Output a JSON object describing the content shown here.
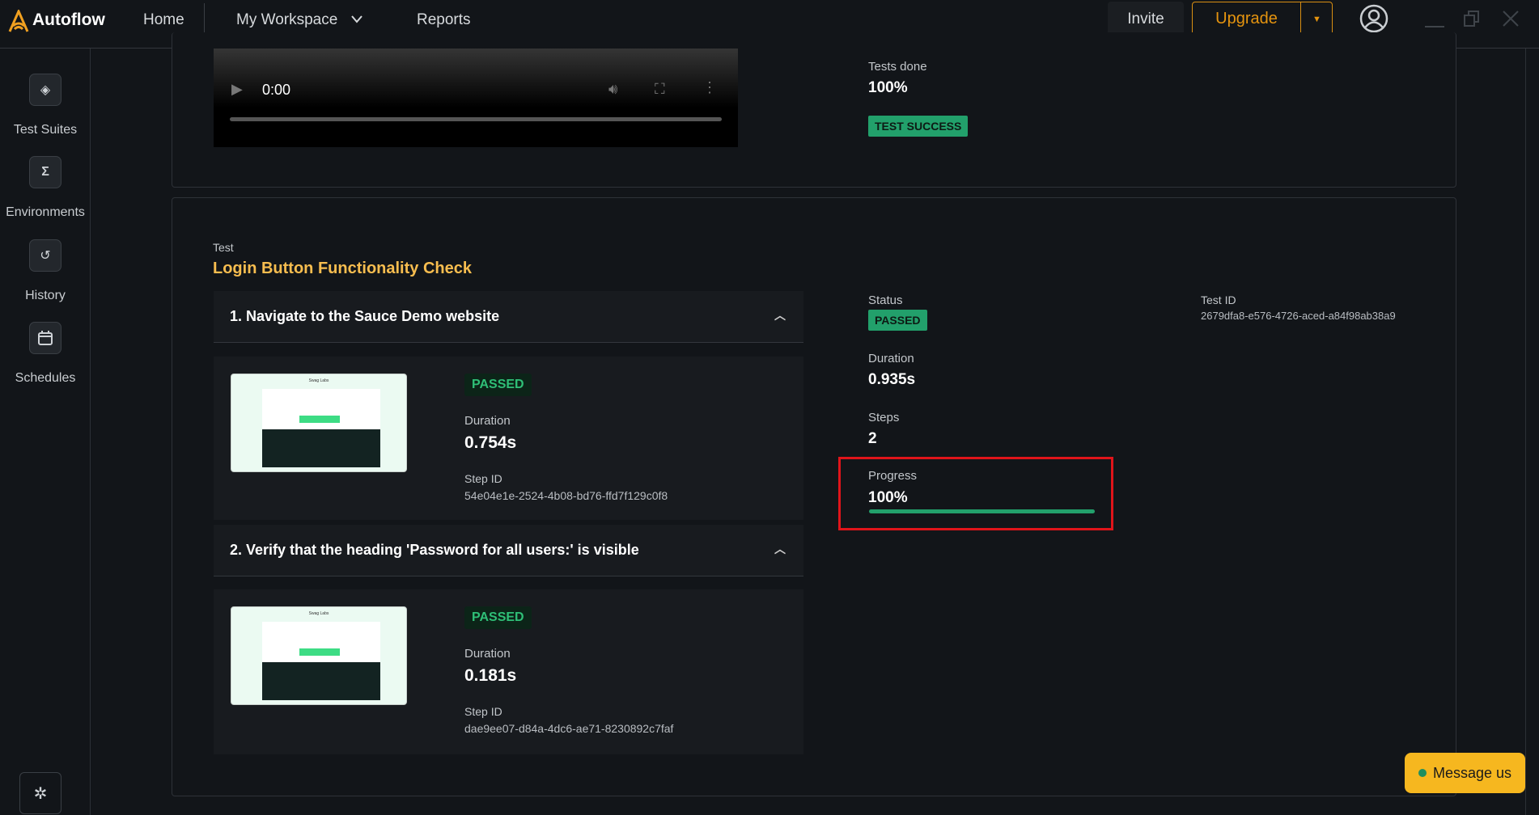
{
  "app": {
    "name": "Autoflow",
    "brand_color": "#f0a020"
  },
  "nav": {
    "home": "Home",
    "workspace": "My Workspace",
    "reports": "Reports",
    "invite": "Invite",
    "upgrade": "Upgrade"
  },
  "sidebar": {
    "items": [
      {
        "label": "Test Suites",
        "icon": "layers-icon"
      },
      {
        "label": "Environments",
        "icon": "sigma-icon"
      },
      {
        "label": "History",
        "icon": "history-icon"
      },
      {
        "label": "Schedules",
        "icon": "calendar-icon"
      }
    ]
  },
  "video": {
    "time": "0:00"
  },
  "summary": {
    "tests_done_label": "Tests done",
    "tests_done_value": "100%",
    "result_badge": "TEST SUCCESS"
  },
  "test": {
    "label": "Test",
    "title": "Login Button Functionality Check",
    "status_label": "Status",
    "status": "PASSED",
    "duration_label": "Duration",
    "duration": "0.935s",
    "steps_label": "Steps",
    "steps": "2",
    "progress_label": "Progress",
    "progress": "100%",
    "progress_fraction": 1.0,
    "test_id_label": "Test ID",
    "test_id": "2679dfa8-e576-4726-aced-a84f98ab38a9"
  },
  "steps": [
    {
      "title": "1. Navigate to the Sauce Demo website",
      "status": "PASSED",
      "duration_label": "Duration",
      "duration": "0.754s",
      "step_id_label": "Step ID",
      "step_id": "54e04e1e-2524-4b08-bd76-ffd7f129c0f8"
    },
    {
      "title": "2. Verify that the heading 'Password for all users:' is visible",
      "status": "PASSED",
      "duration_label": "Duration",
      "duration": "0.181s",
      "step_id_label": "Step ID",
      "step_id": "dae9ee07-d84a-4dc6-ae71-8230892c7faf"
    }
  ],
  "thumbnail": {
    "site_title": "Swag Labs"
  },
  "chat": {
    "label": "Message us"
  }
}
